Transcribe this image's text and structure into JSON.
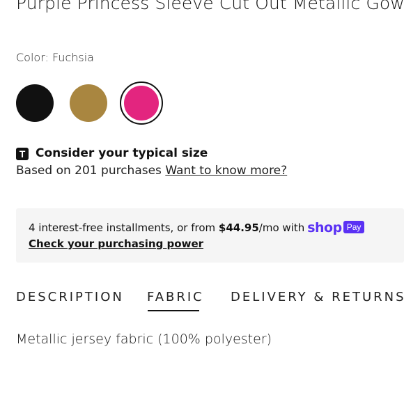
{
  "product": {
    "title": "Purple Princess Sleeve Cut Out Metallic Gown"
  },
  "color": {
    "label": "Color: Fuchsia",
    "swatches": [
      {
        "name": "Black",
        "hex": "#111111",
        "selected": false
      },
      {
        "name": "Gold",
        "hex": "#a98640",
        "selected": false
      },
      {
        "name": "Fuchsia",
        "hex": "#e3257f",
        "selected": true
      }
    ]
  },
  "size": {
    "icon": "T",
    "heading": "Consider your typical size",
    "based_on": "Based on 201 purchases ",
    "link": "Want to know more?"
  },
  "shoppay": {
    "text_before": "4 interest-free installments, or from ",
    "amount": "$44.95",
    "text_after": "/mo with",
    "logo_shop": "shop",
    "logo_pay": "Pay",
    "link": "Check your purchasing power",
    "brand_color": "#5a31f4"
  },
  "tabs": [
    {
      "label": "DESCRIPTION",
      "active": false
    },
    {
      "label": "FABRIC",
      "active": true
    },
    {
      "label": "DELIVERY & RETURNS",
      "active": false
    }
  ],
  "fabric": {
    "text": "Metallic jersey fabric (100% polyester)"
  }
}
